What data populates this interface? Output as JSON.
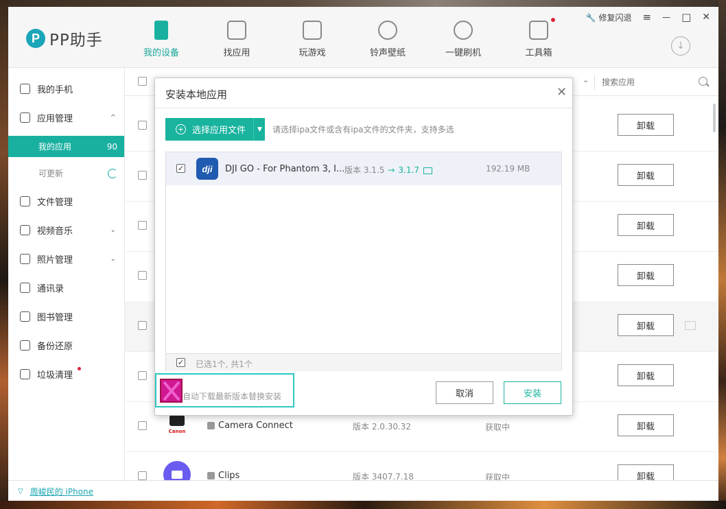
{
  "app": {
    "name": "PP助手",
    "logo_letter": "P"
  },
  "nav": [
    {
      "label": "我的设备",
      "icon": "phone-icon",
      "active": true
    },
    {
      "label": "找应用",
      "icon": "app-bag-icon"
    },
    {
      "label": "玩游戏",
      "icon": "gamepad-icon"
    },
    {
      "label": "铃声壁纸",
      "icon": "star-badge-icon"
    },
    {
      "label": "一键刷机",
      "icon": "refresh-icon"
    },
    {
      "label": "工具箱",
      "icon": "toolbox-icon",
      "badge": true
    }
  ],
  "titlebar": {
    "repair_label": "修复闪退",
    "menu_icon": "≡",
    "min_icon": "—",
    "max_icon": "□",
    "close_icon": "✕",
    "download_icon": "↓"
  },
  "sidebar": {
    "my_phone": "我的手机",
    "app_manage": "应用管理",
    "my_apps": "我的应用",
    "my_apps_count": "90",
    "updatable": "可更新",
    "file_manage": "文件管理",
    "video_music": "视频音乐",
    "photo_manage": "照片管理",
    "contacts": "通讯录",
    "books": "图书管理",
    "backup": "备份还原",
    "cleanup": "垃圾清理",
    "expand_up": "^",
    "expand_down": "⌄"
  },
  "content": {
    "search_placeholder": "搜索应用",
    "sort_chev": "⌄",
    "uninstall_label": "卸载",
    "rows": [
      {
        "name": "",
        "version": "",
        "status": ""
      },
      {
        "name": "",
        "version": "",
        "status": ""
      },
      {
        "name": "",
        "version": "",
        "status": ""
      },
      {
        "name": "",
        "version": "",
        "status": ""
      },
      {
        "name": "",
        "version": "",
        "status": ""
      },
      {
        "name": "",
        "version": "",
        "status": ""
      },
      {
        "name": "Camera Connect",
        "version": "版本 2.0.30.32",
        "status": "获取中",
        "icon_text": "Canon"
      },
      {
        "name": "Clips",
        "version": "版本 3407.7.18",
        "status": "获取中"
      }
    ]
  },
  "bottom": {
    "device_link": "周峻民的 iPhone",
    "chev": "▽"
  },
  "dialog": {
    "title": "安装本地应用",
    "close": "✕",
    "pick_button": "选择应用文件",
    "pick_plus": "+",
    "pick_split": "▼",
    "hint": "请选择ipa文件或含有ipa文件的文件夹，支持多选",
    "file": {
      "name": "DJI GO - For Phantom 3, I...",
      "icon_text": "dji",
      "version_prefix": "版本 3.1.5",
      "arrow": "→",
      "version_new": "3.1.7",
      "size": "192.19 MB",
      "checked": "✓"
    },
    "summary": "已选1个, 共1个",
    "summary_check": "✓",
    "auto_download": "自动下载最新版本替换安装",
    "cancel": "取消",
    "install": "安装"
  },
  "colors": {
    "accent": "#19b39e",
    "link": "#18a4b0",
    "badge": "#e0203a",
    "highlight_box": "#2ec8c2",
    "mark_fill": "#d01890"
  }
}
